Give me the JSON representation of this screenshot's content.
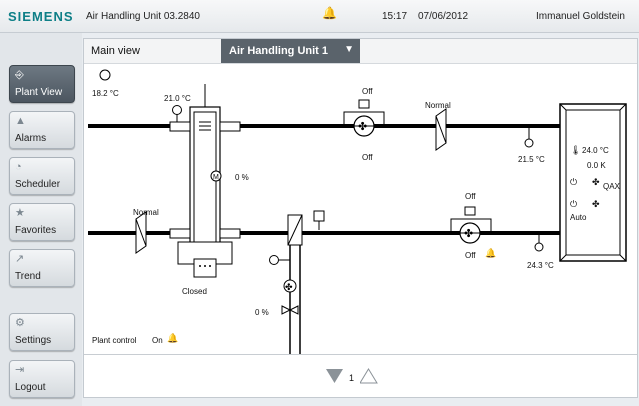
{
  "topbar": {
    "brand": "SIEMENS",
    "title": "Air Handling Unit 03.2840",
    "time": "15:17",
    "date": "07/06/2012",
    "user": "Immanuel Goldstein",
    "bell_color": "#d11a1a"
  },
  "sidebar": {
    "items": [
      {
        "label": "Plant View",
        "icon": "plant-view-icon",
        "active": true
      },
      {
        "label": "Alarms",
        "icon": "bell-icon"
      },
      {
        "label": "Scheduler",
        "icon": "clock-icon"
      },
      {
        "label": "Favorites",
        "icon": "star-icon"
      },
      {
        "label": "Trend",
        "icon": "trend-icon"
      },
      {
        "label": "Settings",
        "icon": "gear-icon"
      },
      {
        "label": "Logout",
        "icon": "logout-icon"
      }
    ]
  },
  "header": {
    "main_view": "Main view",
    "selected_unit": "Air Handling Unit 1"
  },
  "diagram": {
    "outside_temp": "18.2 °C",
    "supply_temp_left": "21.0 °C",
    "fan_top_mode": "Off",
    "fan_top_state": "Off",
    "filter_top_status": "Normal",
    "temp_top_right": "21.5 °C",
    "damper_position": "0 %",
    "filter_bottom_status": "Normal",
    "fan_bottom_mode": "Off",
    "fan_bottom_state": "Off",
    "temp_bottom_right": "24.3 °C",
    "damper_state": "Closed",
    "valve_position": "0 %",
    "room_temp": "24.0 °C",
    "room_k": "0.0 K",
    "room_device": "QAX",
    "room_mode": "Auto",
    "plant_control_label": "Plant control",
    "plant_control_value": "On"
  },
  "pager": {
    "page": "1"
  },
  "colors": {
    "accent": "#0e7f87",
    "alarm": "#d11a1a",
    "nav_active": "#5a636b"
  }
}
